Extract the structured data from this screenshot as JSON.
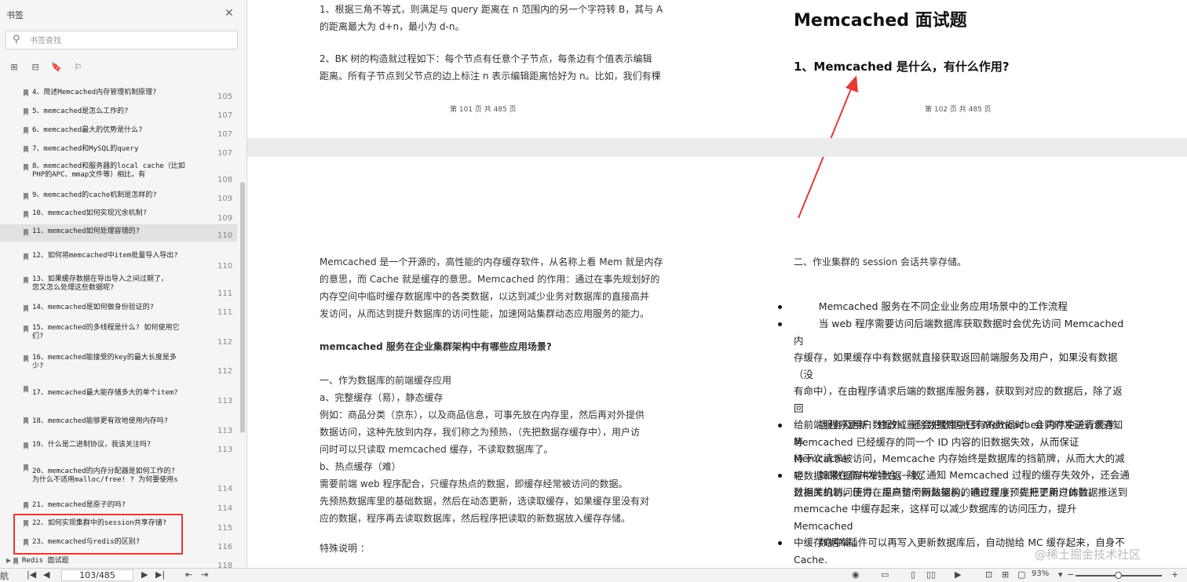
{
  "sidebar": {
    "title": "书签",
    "search_placeholder": "书签查找",
    "bookmarks": [
      {
        "text": "4、简述Memcached内存管理机制原理?",
        "page": "105"
      },
      {
        "text": "5、memcached是怎么工作的?",
        "page": "107"
      },
      {
        "text": "6、memcached最大的优势是什么?",
        "page": "107"
      },
      {
        "text": "7、memcached和MySQL的query",
        "page": "107"
      },
      {
        "text": "8、memcached和服务器的local cache（比如\nPHP的APC、mmap文件等）相比，有",
        "page": "108"
      },
      {
        "text": "9、memcached的cache机制是怎样的?",
        "page": "109"
      },
      {
        "text": "10、memcached如何实现冗余机制?",
        "page": "109"
      },
      {
        "text": "11、memcached如何处理容错的?",
        "page": "110",
        "selected": true
      },
      {
        "text": "12、如何将memcached中item批量导入导出?",
        "page": "110"
      },
      {
        "text": "13、如果缓存数据在导出导入之间过期了，\n您又怎么处理这些数据呢?",
        "page": "111"
      },
      {
        "text": "14、memcached是如何做身份验证的?",
        "page": "111"
      },
      {
        "text": "15、memcached的多线程是什么? 如何使用它\n们?",
        "page": "112"
      },
      {
        "text": "16、memcached能接受的key的最大长度是多\n少?",
        "page": "112"
      },
      {
        "text": "17、memcached最大能存储多大的单个item?",
        "page": "113"
      },
      {
        "text": "18、memcached能够更有效地使用内存吗?",
        "page": "113"
      },
      {
        "text": "19、什么是二进制协议，我该关注吗?",
        "page": "113"
      },
      {
        "text": "20、memcached的内存分配器是如何工作的?\n为什么不适用malloc/free! ? 为何要使用s",
        "page": "114"
      },
      {
        "text": "21、memcached是原子的吗?",
        "page": "114"
      },
      {
        "text": "22、如何实现集群中的session共享存储?",
        "page": "115"
      },
      {
        "text": "23、memcached与redis的区别?",
        "page": "116"
      }
    ],
    "root_item": {
      "text": "Redis 面试题",
      "page": "118"
    }
  },
  "page_left_top": {
    "para1": "1、根据三角不等式，则满足与 query 距离在 n 范围内的另一个字符转 B，其与 A\n的距离最大为 d+n，最小为 d-n。",
    "para2": "2、BK 树的构造就过程如下：每个节点有任意个子节点，每条边有个值表示编辑\n距离。所有子节点到父节点的边上标注 n 表示编辑距离恰好为 n。比如，我们有棵",
    "footer": "第 101 页 共 485 页"
  },
  "page_right_top": {
    "title": "Memcached 面试题",
    "subtitle": "1、Memcached 是什么，有什么作用?",
    "footer": "第 102 页 共 485 页"
  },
  "page_left_bottom": {
    "intro": "Memcached 是一个开源的，高性能的内存缓存软件，从名称上看 Mem 就是内存\n的意思，而 Cache 就是缓存的意思。Memcached 的作用：通过在事先规划好的\n内存空间中临时缓存数据库中的各类数据，以达到减少业务对数据库的直接高并\n发访问，从而达到提升数据库的访问性能，加速网站集群动态应用服务的能力。",
    "heading": "memcached 服务在企业集群架构中有哪些应用场景?",
    "body": "一、作为数据库的前端缓存应用\na、完整缓存（易），静态缓存\n例如：商品分类（京东），以及商品信息，可事先放在内存里，然后再对外提供\n数据访问，这种先放到内存，我们称之为预热，（先把数据存缓存中），用户访\n问时可以只读取 memcached 缓存，不读取数据库了。\nb、热点缓存（难）\n需要前端 web 程序配合，只缓存热点的数据，即缓存经常被访问的数据。\n先预热数据库里的基础数据，然后在动态更新，选读取缓存，如果缓存里没有对\n应的数据，程序再去读取数据库，然后程序把读取的新数据放入缓存存储。",
    "note": "特殊说明 ："
  },
  "page_right_bottom": {
    "intro": "二、作业集群的 session 会话共享存储。",
    "bullets": [
      "        Memcached 服务在不同企业业务应用场景中的工作流程",
      "        当 web 程序需要访问后端数据库获取数据时会优先访问 Memcached 内\n存缓存，如果缓存中有数据就直接获取返回前端服务及用户，如果没有数据（没\n有命中），在由程序请求后端的数据库服务器，获取到对应的数据后，除了返回\n给前端服务及用户数据外，还会把数据放到 Memcached 内存中进行缓存，等\n待下次请求被访问，Memcache 内存始终是数据库的挡箭牌，从而大大的减轻\n数据库的访问压力，提高整个网站架构的响应速度，提升了用户体验。",
      "        当程序更新，修改或删除数据库中已有的数据时，会同时发送请求通知\nMemcached 已经缓存的同一个 ID 内容的旧数据失效，从而保证 Memcache\n中数据和数据库中的数据一致。",
      "        如果在高并发场合，除了通知 Memcached 过程的缓存失效外，还会通\n过相关机制，使得在用户访问新数据前，通过程序预先把更新过的数据推送到\nmemcache 中缓存起来，这样可以减少数据库的访问压力，提升 Memcached\n中缓存命中率。",
      "        数据库插件可以再写入更新数据库后，自动抛给 MC 缓存起来，自身不\nCache."
    ]
  },
  "watermark": "@稀土掘金技术社区",
  "bottom_bar": {
    "left_label": "航",
    "page_value": "103/485",
    "zoom": "93%"
  },
  "colors": {
    "highlight": "#e53935",
    "arrow": "#e53935"
  }
}
